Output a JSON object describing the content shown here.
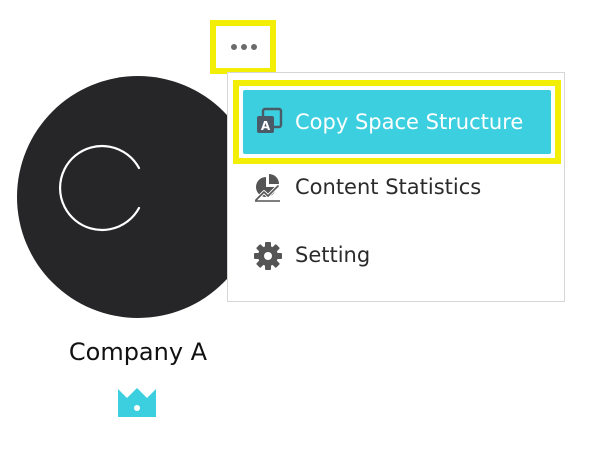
{
  "space": {
    "avatar_letter": "C",
    "name": "Company A"
  },
  "icons": {
    "more": "more-horizontal-icon",
    "copy": "copy-structure-icon",
    "stats": "chart-statistics-icon",
    "setting": "gear-icon",
    "crown": "crown-icon"
  },
  "menu": {
    "items": [
      {
        "label": "Copy Space Structure",
        "icon": "copy-structure-icon",
        "highlighted": true
      },
      {
        "label": "Content Statistics",
        "icon": "chart-statistics-icon"
      },
      {
        "label": "Setting",
        "icon": "gear-icon"
      }
    ]
  },
  "colors": {
    "highlight_outline": "#f2ee05",
    "active_item": "#3ccfdf",
    "crown": "#3ccfdf",
    "avatar_bg": "#262628"
  }
}
